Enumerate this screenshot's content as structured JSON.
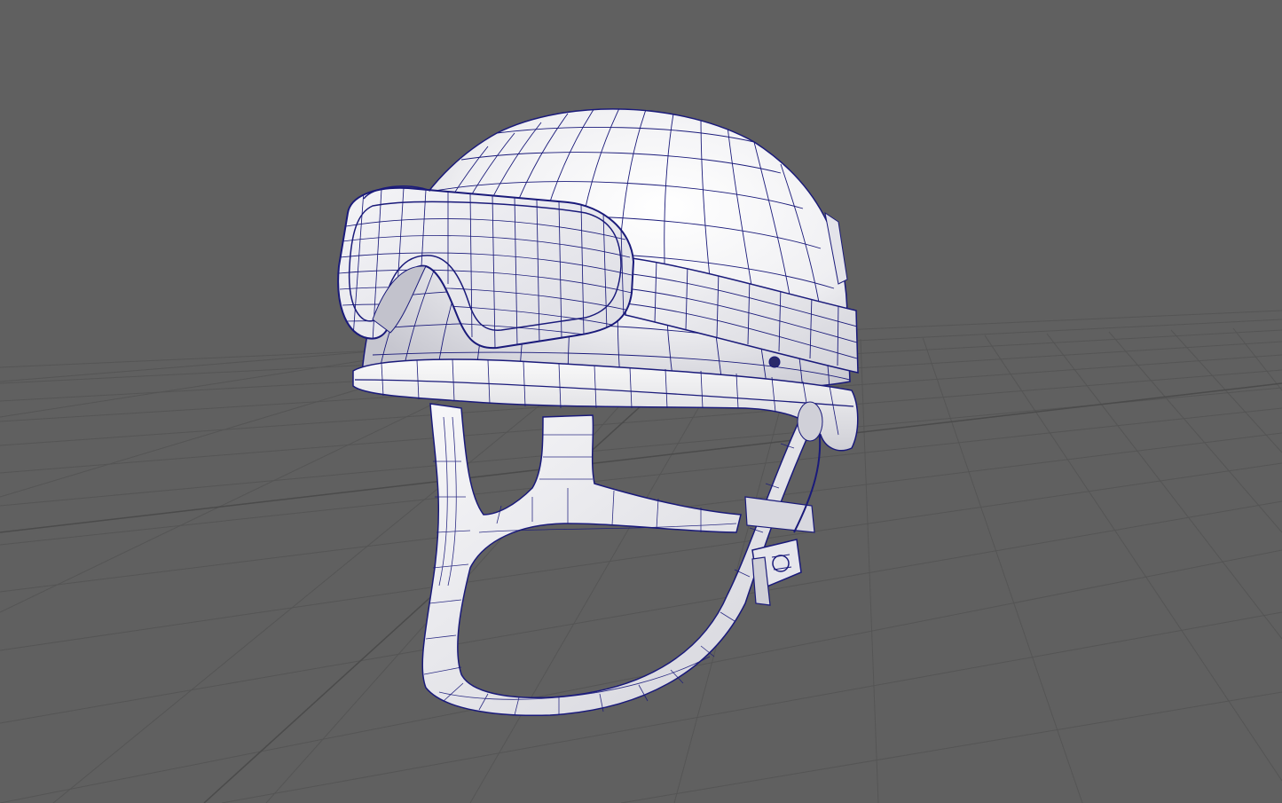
{
  "viewport": {
    "background_color": "#606060",
    "grid_line_color": "#555555",
    "grid_axis_color": "#4b4b4b",
    "mesh_fill_color": "#f2f2f4",
    "mesh_shade_color": "#c9c9d1",
    "wire_color": "#1a1a7a"
  },
  "model": {
    "parts": [
      "helmet-shell",
      "goggles",
      "goggle-strap",
      "helmet-rim",
      "chin-strap-frame",
      "strap-buckle",
      "side-rivet"
    ]
  }
}
